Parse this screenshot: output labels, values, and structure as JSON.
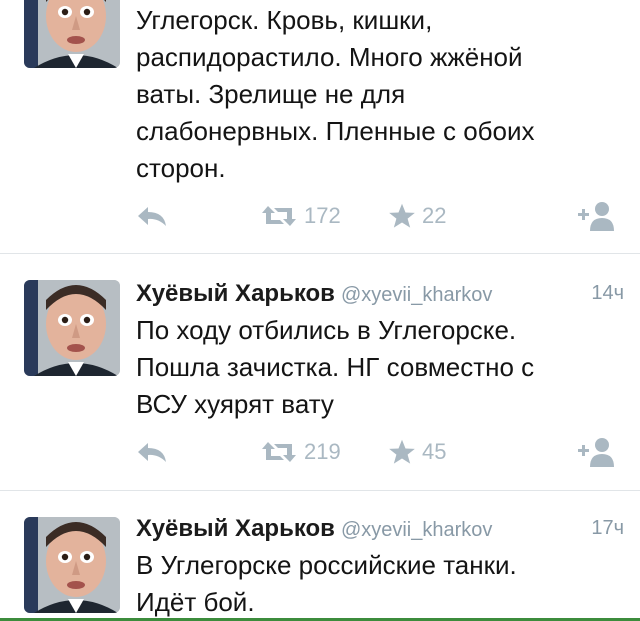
{
  "tweets": [
    {
      "name": "",
      "handle": "",
      "time": "",
      "lines": [
        "Углегорск. Кровь, кишки,",
        "распидорастило. Много жжёной",
        "ваты. Зрелище не для",
        "слабонервных. Пленные с обоих",
        "сторон."
      ],
      "retweets": "172",
      "favorites": "22"
    },
    {
      "name": "Хуёвый Харьков",
      "handle": "@xyevii_kharkov",
      "time": "14ч",
      "lines": [
        "По ходу отбились в Углегорске.",
        "Пошла зачистка. НГ совместно с",
        "ВСУ хуярят вату"
      ],
      "retweets": "219",
      "favorites": "45"
    },
    {
      "name": "Хуёвый Харьков",
      "handle": "@xyevii_kharkov",
      "time": "17ч",
      "lines": [
        "В Углегорске российские танки.",
        "Идёт бой."
      ],
      "retweets": "",
      "favorites": ""
    }
  ],
  "icons": {
    "reply": "reply-icon",
    "retweet": "retweet-icon",
    "favorite": "star-icon",
    "follow": "follow-icon"
  },
  "colors": {
    "meta_gray": "#8899a6",
    "icon_gray": "#aab8c2",
    "divider": "#e1e5e8"
  }
}
